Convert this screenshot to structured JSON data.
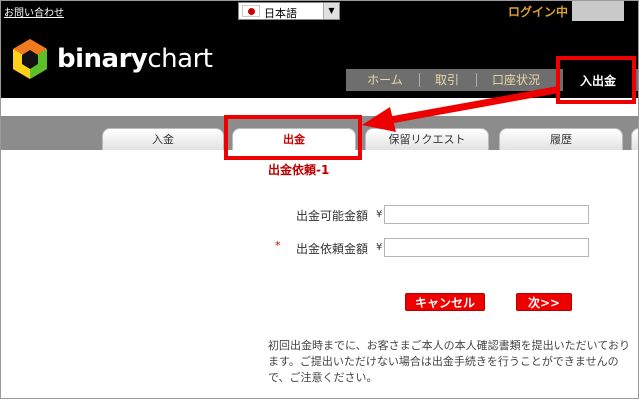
{
  "topbar": {
    "contact": "お問い合わせ",
    "language": "日本語",
    "login_status": "ログイン中"
  },
  "header": {
    "brand_bold": "binary",
    "brand_light": "chart"
  },
  "nav": {
    "items": [
      "ホーム",
      "取引",
      "口座状況"
    ],
    "active": "入出金"
  },
  "tabs": [
    "入金",
    "出金",
    "保留リクエスト",
    "履歴"
  ],
  "form": {
    "title": "出金依頼-1",
    "available_label": "出金可能金額",
    "request_label": "出金依頼金額",
    "required_mark": "*",
    "currency": "¥",
    "available_value": "",
    "request_value": "",
    "cancel_label": "キャンセル",
    "next_label": "次>>"
  },
  "notice": "初回出金時までに、お客さまご本人の本人確認書類を提出いただいております。ご提出いただけない場合は出金手続きを行うことができませんので、ご注意ください。",
  "colors": {
    "accent_red": "#ee0000",
    "nav_text": "#e9d7a7",
    "login_gold": "#d9a030"
  }
}
